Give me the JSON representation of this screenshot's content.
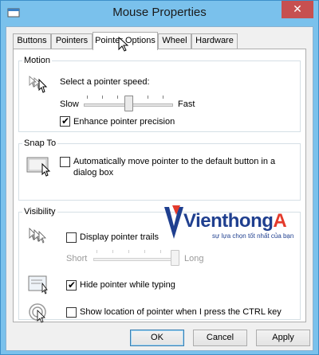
{
  "window": {
    "title": "Mouse Properties",
    "close_glyph": "✕"
  },
  "tabs": [
    {
      "label": "Buttons"
    },
    {
      "label": "Pointers"
    },
    {
      "label": "Pointer Options",
      "active": true
    },
    {
      "label": "Wheel"
    },
    {
      "label": "Hardware"
    }
  ],
  "motion": {
    "group_label": "Motion",
    "icon": "pointer-speed-icon",
    "prompt": "Select a pointer speed:",
    "slow_label": "Slow",
    "fast_label": "Fast",
    "speed_level": 0.5,
    "enhance_precision": {
      "label": "Enhance pointer precision",
      "checked": true
    }
  },
  "snap_to": {
    "group_label": "Snap To",
    "icon": "snap-to-button-icon",
    "auto_move": {
      "label_line1": "Automatically move pointer to the default button in a",
      "label_line2": "dialog box",
      "checked": false
    }
  },
  "visibility": {
    "group_label": "Visibility",
    "trails": {
      "icon": "pointer-trails-icon",
      "label": "Display pointer trails",
      "checked": false
    },
    "short_label": "Short",
    "long_label": "Long",
    "trail_level": 1.0,
    "hide_typing": {
      "icon": "hide-pointer-icon",
      "label": "Hide pointer while typing",
      "checked": true
    },
    "show_location": {
      "icon": "pointer-location-icon",
      "label": "Show location of pointer when I press the CTRL key",
      "checked": false
    }
  },
  "watermark": {
    "brand_main": "Vienthong",
    "brand_accent": "A",
    "tagline": "sự lựa chọn tốt nhất của bạn",
    "colors": {
      "blue": "#1f3f8f",
      "red": "#e43b2c"
    }
  },
  "buttons": {
    "ok": "OK",
    "cancel": "Cancel",
    "apply": "Apply"
  },
  "check_glyph": "✔"
}
